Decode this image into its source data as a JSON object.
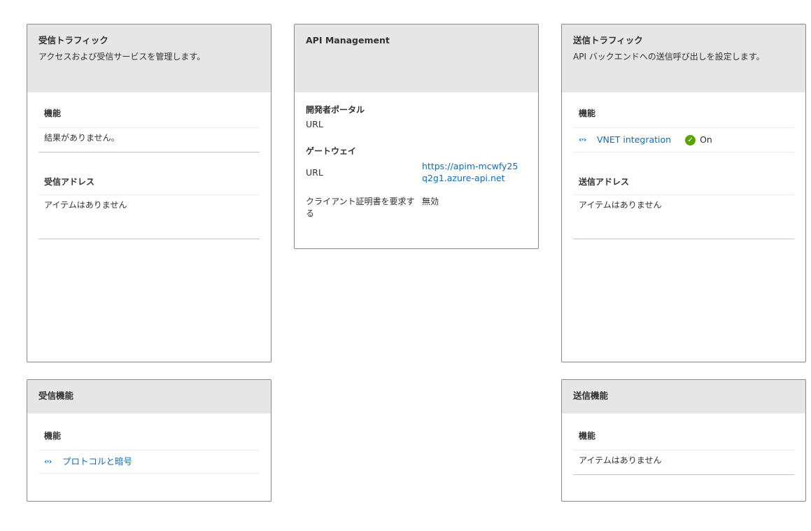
{
  "inbound_traffic": {
    "title": "受信トラフィック",
    "subtitle": "アクセスおよび受信サービスを管理します。",
    "features_title": "機能",
    "features_empty": "結果がありません。",
    "addresses_title": "受信アドレス",
    "addresses_empty": "アイテムはありません"
  },
  "api_management": {
    "title": "API Management",
    "dev_portal_title": "開発者ポータル",
    "dev_portal_url_label": "URL",
    "gateway_title": "ゲートウェイ",
    "gateway_url_label": "URL",
    "gateway_url_value": "https://apim-mcwfy25q2g1.azure-api.net",
    "client_cert_label": "クライアント証明書を要求する",
    "client_cert_value": "無効"
  },
  "outbound_traffic": {
    "title": "送信トラフィック",
    "subtitle": "API バックエンドへの送信呼び出しを設定します。",
    "features_title": "機能",
    "vnet_label": "VNET integration",
    "vnet_status": "On",
    "addresses_title": "送信アドレス",
    "addresses_empty": "アイテムはありません"
  },
  "inbound_features": {
    "title": "受信機能",
    "features_title": "機能",
    "protocols_label": "プロトコルと暗号"
  },
  "outbound_features": {
    "title": "送信機能",
    "features_title": "機能",
    "features_empty": "アイテムはありません"
  },
  "colors": {
    "header_bg": "#e6e6e6",
    "link": "#0f6cbd",
    "success": "#57a300",
    "border": "#8a8886"
  },
  "icons": {
    "network": "network-connector-icon",
    "success": "check-circle-icon"
  }
}
